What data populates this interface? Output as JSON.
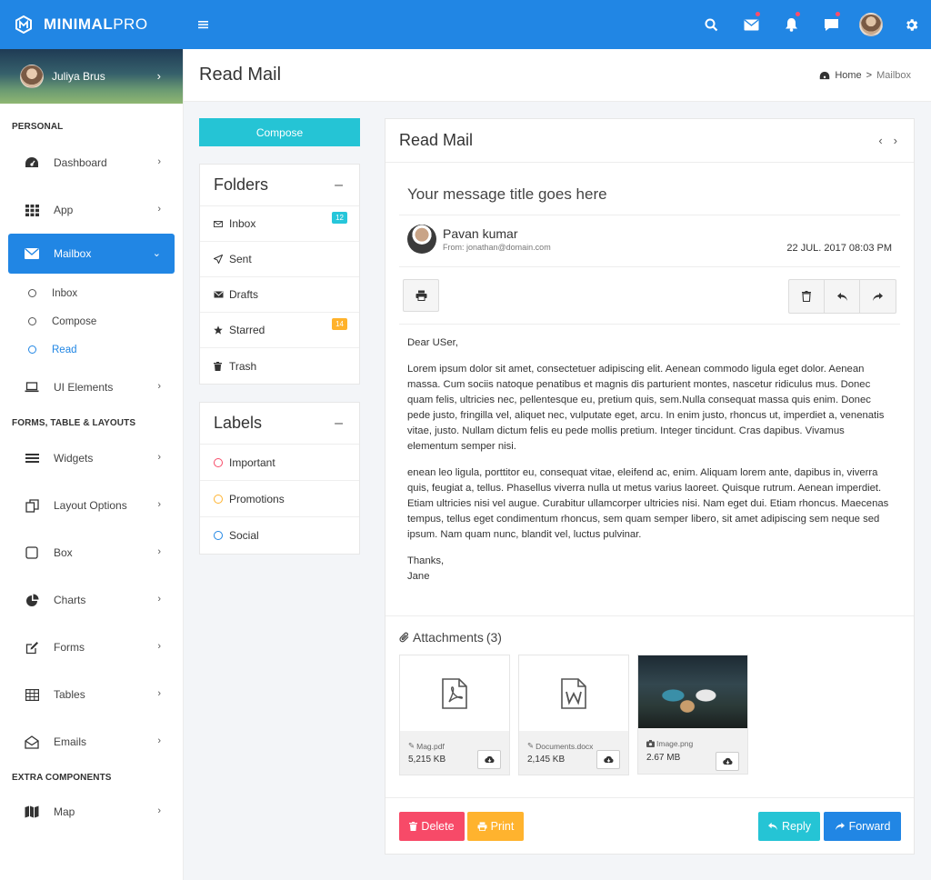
{
  "brand": {
    "name_bold": "MINIMAL",
    "name_light": "PRO"
  },
  "colors": {
    "primary": "#2186e4",
    "cyan": "#25c4d5",
    "red": "#f74a68",
    "orange": "#ffb32e",
    "badge_cyan": "#26c6da",
    "badge_orange": "#ffb22b"
  },
  "user": {
    "name": "Juliya Brus"
  },
  "sidebar": {
    "sections": [
      "PERSONAL",
      "FORMS, TABLE & LAYOUTS",
      "EXTRA COMPONENTS"
    ],
    "items": [
      {
        "label": "Dashboard",
        "icon": "dashboard-icon"
      },
      {
        "label": "App",
        "icon": "grid-icon"
      },
      {
        "label": "Mailbox",
        "icon": "envelope-icon"
      },
      {
        "label": "UI Elements",
        "icon": "laptop-icon"
      },
      {
        "label": "Widgets",
        "icon": "bars-icon"
      },
      {
        "label": "Layout Options",
        "icon": "copy-icon"
      },
      {
        "label": "Box",
        "icon": "square-icon"
      },
      {
        "label": "Charts",
        "icon": "pie-chart-icon"
      },
      {
        "label": "Forms",
        "icon": "edit-icon"
      },
      {
        "label": "Tables",
        "icon": "table-icon"
      },
      {
        "label": "Emails",
        "icon": "envelope-open-icon"
      },
      {
        "label": "Map",
        "icon": "map-icon"
      }
    ],
    "mailbox_sub": [
      "Inbox",
      "Compose",
      "Read"
    ]
  },
  "header": {
    "title": "Read Mail",
    "breadcrumb": {
      "home": "Home",
      "sep": ">",
      "current": "Mailbox"
    }
  },
  "compose_label": "Compose",
  "folders": {
    "title": "Folders",
    "collapse": "–",
    "items": [
      {
        "label": "Inbox",
        "badge": "12"
      },
      {
        "label": "Sent",
        "badge": ""
      },
      {
        "label": "Drafts",
        "badge": ""
      },
      {
        "label": "Starred",
        "badge": "14"
      },
      {
        "label": "Trash",
        "badge": ""
      }
    ]
  },
  "labels": {
    "title": "Labels",
    "collapse": "–",
    "items": [
      {
        "label": "Important",
        "color": "#f74a68"
      },
      {
        "label": "Promotions",
        "color": "#ffb32e"
      },
      {
        "label": "Social",
        "color": "#2186e4"
      }
    ]
  },
  "mail": {
    "panel_title": "Read Mail",
    "subject": "Your message title goes here",
    "sender_name": "Pavan kumar",
    "sender_from": "From: jonathan@domain.com",
    "date": "22 JUL. 2017 08:03 PM",
    "greeting": "Dear USer,",
    "para1": "Lorem ipsum dolor sit amet, consectetuer adipiscing elit. Aenean commodo ligula eget dolor. Aenean massa. Cum sociis natoque penatibus et magnis dis parturient montes, nascetur ridiculus mus. Donec quam felis, ultricies nec, pellentesque eu, pretium quis, sem.Nulla consequat massa quis enim. Donec pede justo, fringilla vel, aliquet nec, vulputate eget, arcu. In enim justo, rhoncus ut, imperdiet a, venenatis vitae, justo. Nullam dictum felis eu pede mollis pretium. Integer tincidunt. Cras dapibus. Vivamus elementum semper nisi.",
    "para2": "enean leo ligula, porttitor eu, consequat vitae, eleifend ac, enim. Aliquam lorem ante, dapibus in, viverra quis, feugiat a, tellus. Phasellus viverra nulla ut metus varius laoreet. Quisque rutrum. Aenean imperdiet. Etiam ultricies nisi vel augue. Curabitur ullamcorper ultricies nisi. Nam eget dui. Etiam rhoncus. Maecenas tempus, tellus eget condimentum rhoncus, sem quam semper libero, sit amet adipiscing sem neque sed ipsum. Nam quam nunc, blandit vel, luctus pulvinar.",
    "signoff": "Thanks,",
    "signature": "Jane",
    "attachments_title": "Attachments",
    "attachments_count": "(3)",
    "attachments": [
      {
        "name": "Mag.pdf",
        "size": "5,215 KB",
        "icon": "pdf-file-icon"
      },
      {
        "name": "Documents.docx",
        "size": "2,145 KB",
        "icon": "word-file-icon"
      },
      {
        "name": "Image.png",
        "size": "2.67 MB",
        "icon": "camera-icon"
      }
    ],
    "actions": {
      "delete": "Delete",
      "print": "Print",
      "reply": "Reply",
      "forward": "Forward"
    }
  }
}
